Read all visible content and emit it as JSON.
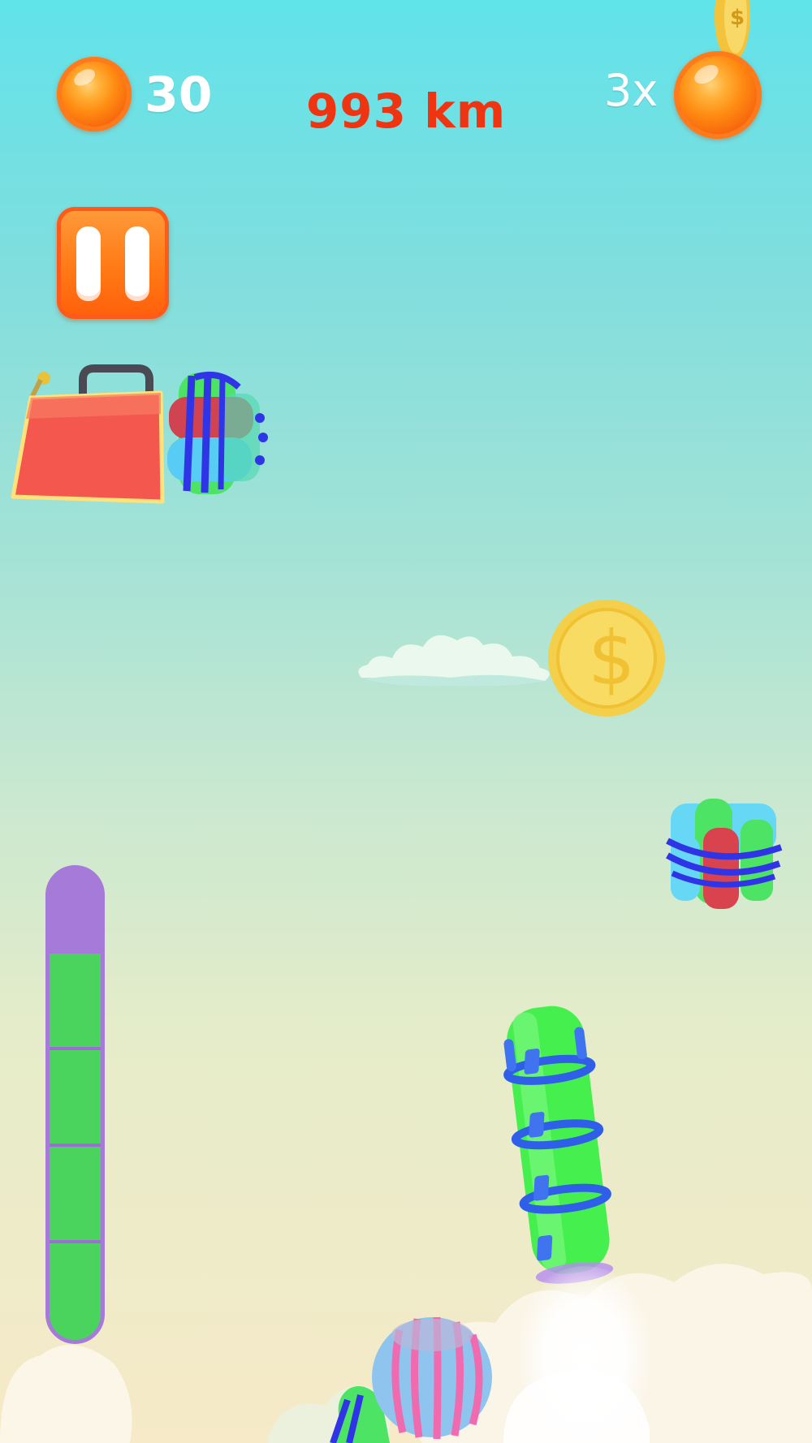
{
  "hud": {
    "coins": "30",
    "distance": "993 km",
    "multiplier": "3x"
  },
  "controls": {
    "pause": {
      "icon": "pause-icon"
    }
  },
  "fuel_gauge": {
    "level": 0.82,
    "segments": 4
  },
  "colors": {
    "distance_text": "#ee3410",
    "coin_orange": "#ff8c12",
    "pause_orange": "#ff7a16",
    "gauge_frame": "#a67ad8",
    "gauge_fill": "#4ad45d",
    "rocket_green": "#45f04e",
    "rocket_bands": "#2f5ee8"
  },
  "scene_objects": [
    "fuel-can-icon",
    "bottle-bundle-icon",
    "dollar-coin-icon",
    "cloud-icon",
    "rocket-icon",
    "balloon-icon"
  ]
}
